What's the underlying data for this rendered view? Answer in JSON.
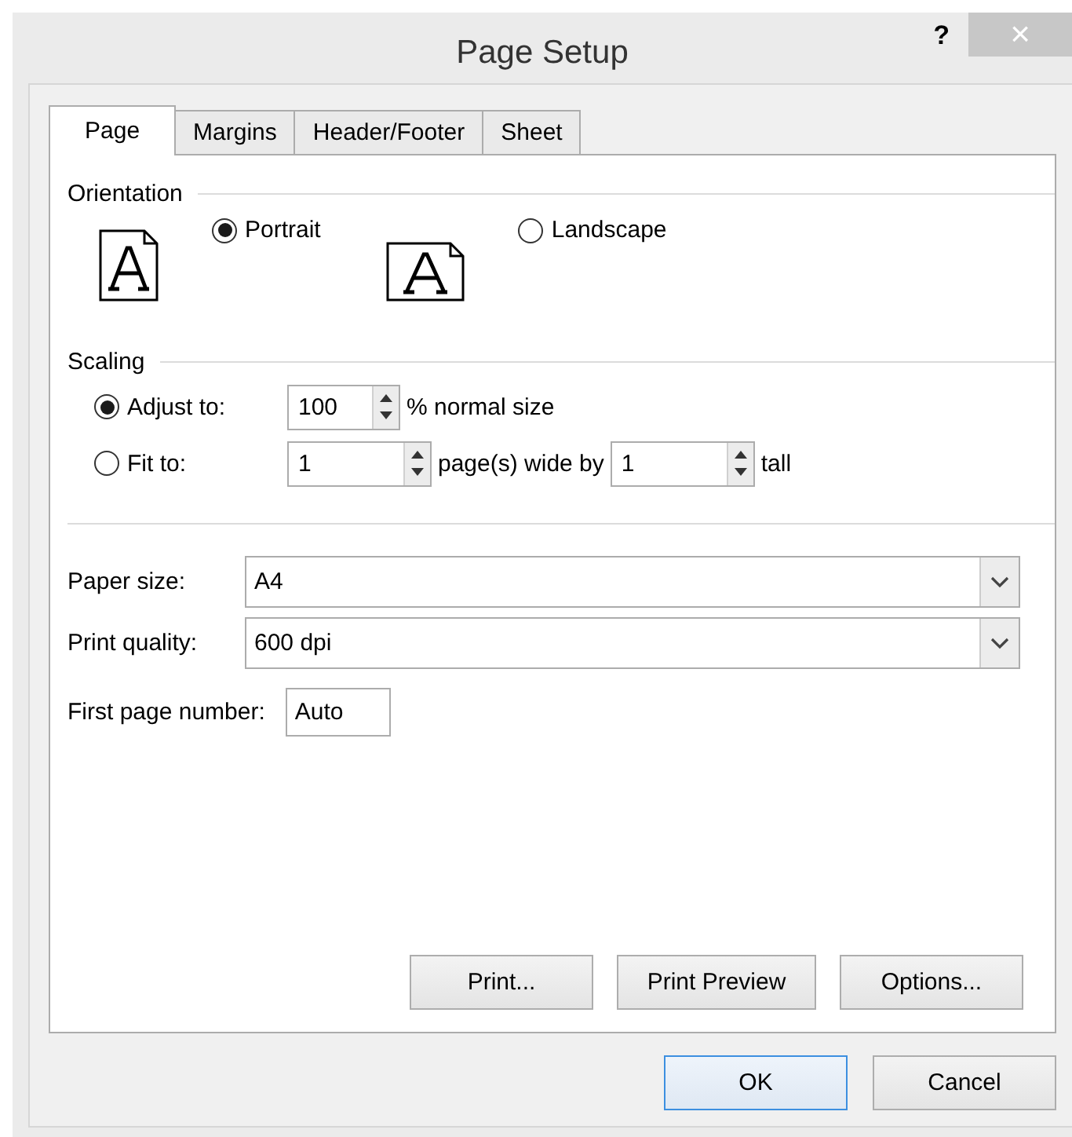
{
  "window": {
    "title": "Page Setup",
    "help": "?",
    "close": "×"
  },
  "tabs": [
    {
      "label": "Page",
      "selected": true
    },
    {
      "label": "Margins",
      "selected": false
    },
    {
      "label": "Header/Footer",
      "selected": false
    },
    {
      "label": "Sheet",
      "selected": false
    }
  ],
  "orientation": {
    "heading": "Orientation",
    "options": [
      {
        "label": "Portrait",
        "kind": "portrait",
        "selected": true
      },
      {
        "label": "Landscape",
        "kind": "landscape",
        "selected": false
      }
    ]
  },
  "scaling": {
    "heading": "Scaling",
    "adjust": {
      "label": "Adjust to:",
      "selected": true,
      "value": "100",
      "suffix": "% normal size"
    },
    "fit": {
      "label": "Fit to:",
      "selected": false,
      "wide_value": "1",
      "wide_suffix": "page(s) wide by",
      "tall_value": "1",
      "tall_suffix": "tall"
    }
  },
  "paper_size": {
    "label": "Paper size:",
    "value": "A4"
  },
  "print_quality": {
    "label": "Print quality:",
    "value": "600 dpi"
  },
  "first_page_number": {
    "label": "First page number:",
    "value": "Auto"
  },
  "panel_buttons": [
    "Print...",
    "Print Preview",
    "Options..."
  ],
  "buttons": [
    {
      "label": "OK",
      "default": true
    },
    {
      "label": "Cancel",
      "default": false
    }
  ]
}
